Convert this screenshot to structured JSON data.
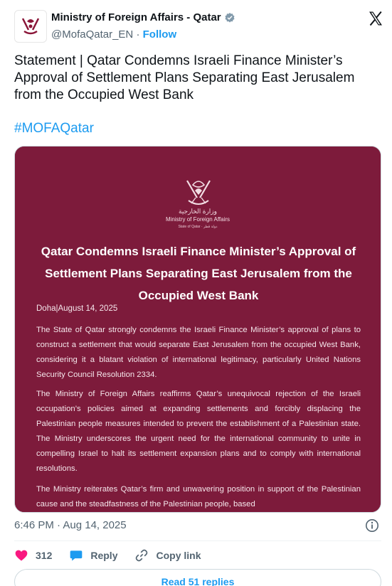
{
  "author": {
    "name": "Ministry of Foreign Affairs - Qatar",
    "handle": "@MofaQatar_EN",
    "separator": "·",
    "follow_label": "Follow"
  },
  "tweet": {
    "text": "Statement | Qatar Condemns Israeli Finance Minister’s Approval of Settlement Plans Separating East Jerusalem from the Occupied West Bank",
    "hashtag": "#MOFAQatar",
    "timestamp": "6:46 PM · Aug 14, 2025"
  },
  "media": {
    "logo_arabic": "وزارة الخارجية",
    "logo_english": "Ministry of Foreign Affairs",
    "logo_state": "State of Qatar · دولة قطر",
    "title": "Qatar Condemns Israeli Finance Minister’s Approval of Settlement Plans Separating East Jerusalem from the Occupied West Bank",
    "dateline": "Doha|August 14, 2025",
    "paragraphs": [
      "The State of Qatar strongly condemns the Israeli Finance Minister’s approval of plans to construct a settlement that would separate East Jerusalem from the occupied West Bank, considering it a blatant violation of international legitimacy, particularly United Nations Security Council Resolution 2334.",
      "The Ministry of Foreign Affairs reaffirms Qatar’s unequivocal rejection of the Israeli occupation’s policies aimed at expanding settlements and forcibly displacing the Palestinian people measures intended to prevent the establishment of a Palestinian state. The Ministry underscores the urgent need for the international community to unite in compelling Israel to halt its settlement expansion plans and to comply with international resolutions.",
      "The Ministry reiterates Qatar’s firm and unwavering position in support of the Palestinian cause and the steadfastness of the Palestinian people, based"
    ],
    "background_color": "#7d1b3b"
  },
  "actions": {
    "like_count": "312",
    "reply_label": "Reply",
    "copy_label": "Copy link",
    "read_replies_label": "Read 51 replies"
  },
  "icons": {
    "verified": "verified-badge-icon",
    "platform": "x-logo-icon",
    "info": "info-icon",
    "like": "heart-icon",
    "reply": "speech-bubble-icon",
    "copy": "link-icon"
  },
  "colors": {
    "accent": "#1d9bf0",
    "like": "#f91880",
    "muted": "#536471",
    "text": "#0f1419"
  }
}
